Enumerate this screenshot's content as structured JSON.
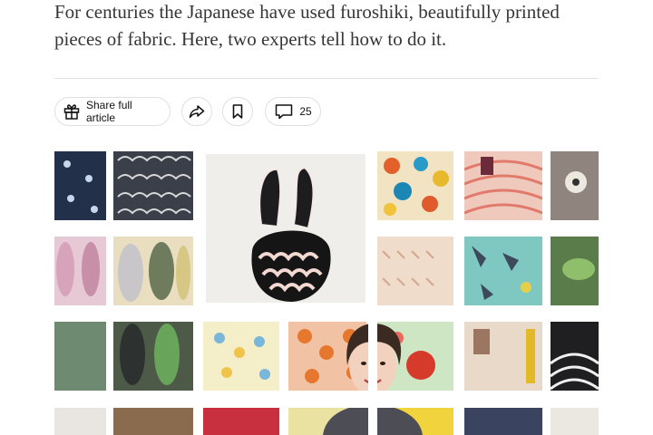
{
  "article": {
    "summary": "For centuries the Japanese have used furoshiki, beautifully printed pieces of fabric. Here, two experts tell how to do it."
  },
  "toolbar": {
    "share_label": "Share full article",
    "share_icon": "gift-icon",
    "forward_icon": "share-arrow-icon",
    "bookmark_icon": "bookmark-icon",
    "comments_icon": "comment-bubble-icon",
    "comments_count": "25"
  },
  "colors": {
    "text": "#363636",
    "border": "#dfdfdf",
    "shelf": "#f4f3f1"
  }
}
